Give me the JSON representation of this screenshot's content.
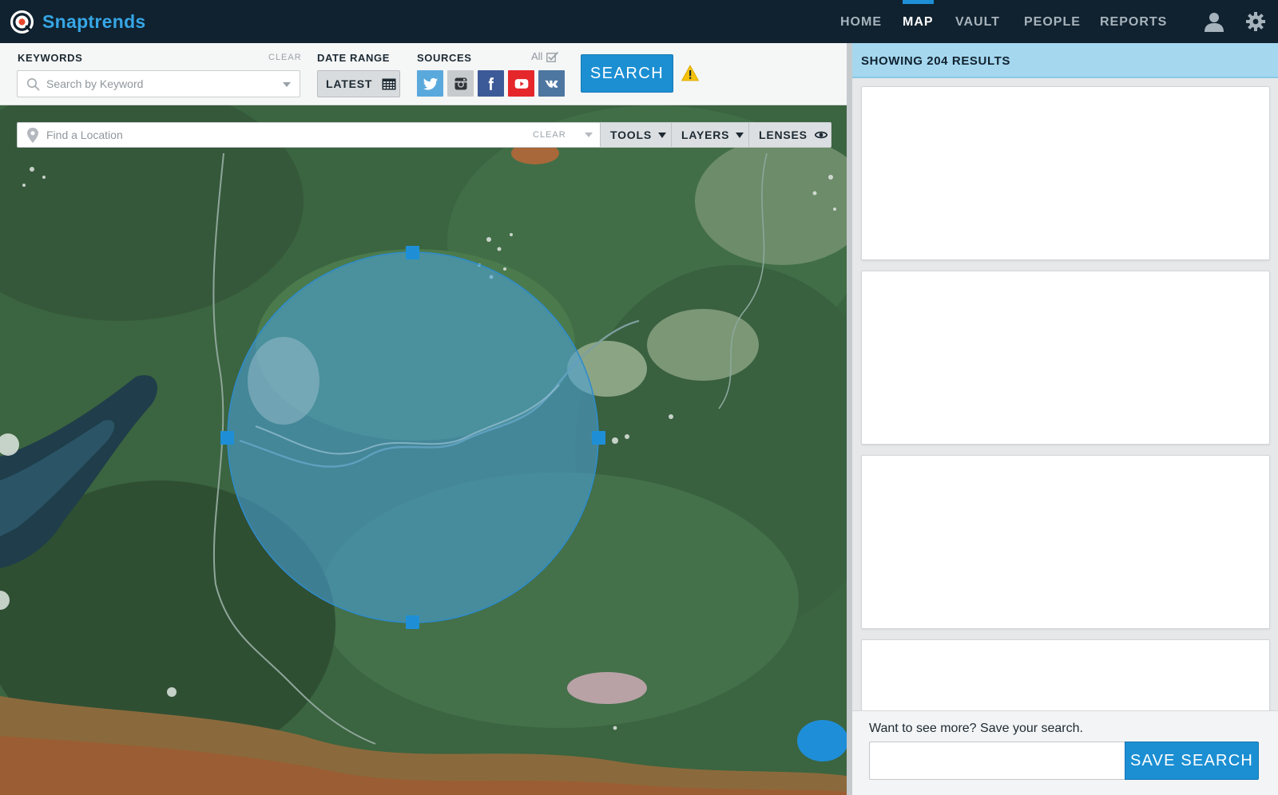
{
  "app": {
    "name": "Snaptrends"
  },
  "nav": {
    "items": [
      {
        "label": "HOME"
      },
      {
        "label": "MAP"
      },
      {
        "label": "VAULT"
      },
      {
        "label": "PEOPLE"
      },
      {
        "label": "REPORTS"
      }
    ],
    "active": "MAP"
  },
  "toolbar": {
    "keywords_label": "KEYWORDS",
    "keywords_clear": "CLEAR",
    "keywords_placeholder": "Search by Keyword",
    "date_range_label": "DATE RANGE",
    "date_range_value": "LATEST",
    "sources_label": "SOURCES",
    "sources_all": "All",
    "sources": [
      {
        "name": "twitter",
        "icon": "twitter-icon",
        "color": "#55acee",
        "bg": "#5aa9dd"
      },
      {
        "name": "instagram",
        "icon": "instagram-icon",
        "color": "#3a3a3a",
        "bg": "#c8cbcd"
      },
      {
        "name": "facebook",
        "icon": "facebook-icon",
        "color": "#3b5998",
        "bg": "#3d5a98"
      },
      {
        "name": "youtube",
        "icon": "youtube-icon",
        "color": "#e52d27",
        "bg": "#e5262b"
      },
      {
        "name": "vk",
        "icon": "vk-icon",
        "color": "#4c75a3",
        "bg": "#4d76a1"
      }
    ],
    "search_label": "SEARCH"
  },
  "map": {
    "location_placeholder": "Find a Location",
    "location_clear": "CLEAR",
    "tools_label": "TOOLS",
    "layers_label": "LAYERS",
    "lenses_label": "LENSES"
  },
  "results": {
    "header": "SHOWING 204 RESULTS",
    "card_count": 4,
    "save_prompt": "Want to see more? Save your search.",
    "save_input_value": "",
    "save_button": "SAVE SEARCH"
  },
  "colors": {
    "navbar": "#10222f",
    "brand": "#36a6e6",
    "accent": "#1c8fd3",
    "results_header": "#a5d7ef",
    "circle_fill": "#4aa0d8"
  }
}
